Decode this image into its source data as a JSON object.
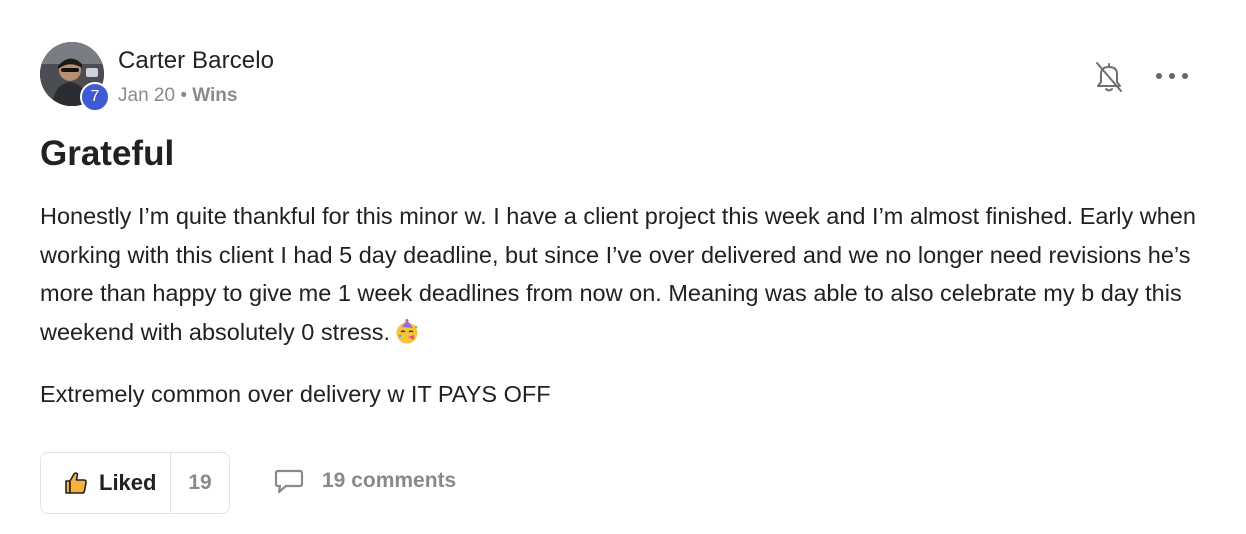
{
  "post": {
    "author": "Carter Barcelo",
    "level": "7",
    "date": "Jan 20",
    "separator": "•",
    "category": "Wins",
    "title": "Grateful",
    "body": "Honestly I’m quite thankful for this minor w. I have a client project this week and I’m almost finished. Early when working with this client I had 5 day deadline, but since I’ve over delivered and we no longer need revisions he’s more than happy to give me 1 week deadlines from now on. Meaning was able to also celebrate my b day this weekend with absolutely 0 stress.",
    "body_emoji": "partying-face",
    "body2": "Extremely common over delivery w IT PAYS OFF"
  },
  "actions": {
    "like_label": "Liked",
    "like_count": "19",
    "comments_label": "19 comments"
  },
  "colors": {
    "level_badge": "#3f5bd2",
    "muted_text": "#8a8a8a",
    "thumb_fill": "#f6b23a"
  },
  "icons": {
    "notify": "bell-off-icon",
    "menu": "more-horizontal-icon",
    "like": "thumbs-up-icon",
    "comment": "comment-icon"
  }
}
